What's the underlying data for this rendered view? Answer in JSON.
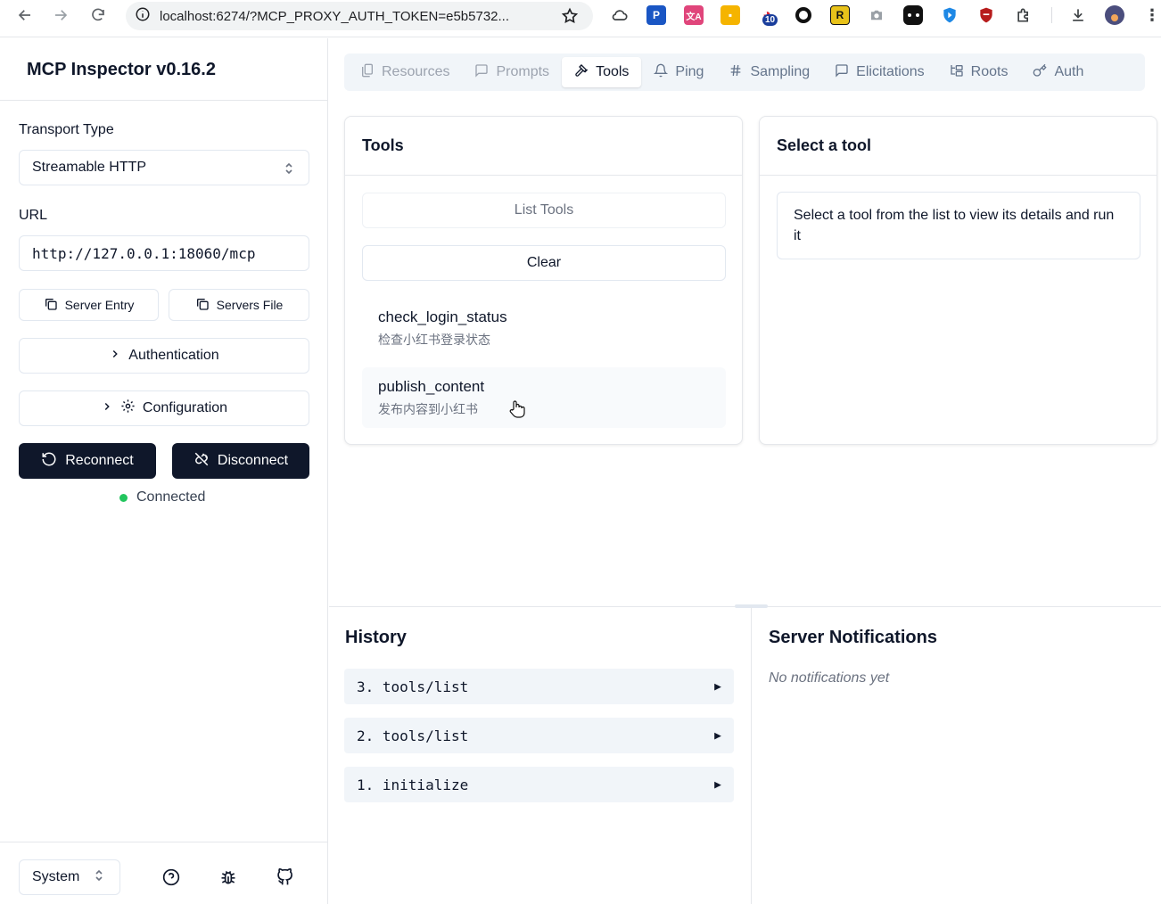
{
  "browser": {
    "url": "localhost:6274/?MCP_PROXY_AUTH_TOKEN=e5b5732...",
    "extension_badge": "10"
  },
  "sidebar": {
    "title": "MCP Inspector v0.16.2",
    "transport_label": "Transport Type",
    "transport_value": "Streamable HTTP",
    "url_label": "URL",
    "url_value": "http://127.0.0.1:18060/mcp",
    "server_entry_label": "Server Entry",
    "servers_file_label": "Servers File",
    "authentication_label": "Authentication",
    "configuration_label": "Configuration",
    "reconnect_label": "Reconnect",
    "disconnect_label": "Disconnect",
    "status_text": "Connected",
    "theme_value": "System"
  },
  "tabs": [
    {
      "label": "Resources",
      "icon": "files-icon",
      "state": "disabled"
    },
    {
      "label": "Prompts",
      "icon": "message-square-icon",
      "state": "disabled"
    },
    {
      "label": "Tools",
      "icon": "hammer-icon",
      "state": "active"
    },
    {
      "label": "Ping",
      "icon": "bell-icon",
      "state": "normal"
    },
    {
      "label": "Sampling",
      "icon": "hash-icon",
      "state": "normal"
    },
    {
      "label": "Elicitations",
      "icon": "message-square-icon",
      "state": "normal"
    },
    {
      "label": "Roots",
      "icon": "folder-tree-icon",
      "state": "normal"
    },
    {
      "label": "Auth",
      "icon": "key-icon",
      "state": "normal"
    }
  ],
  "tools_panel": {
    "title": "Tools",
    "list_tools_label": "List Tools",
    "clear_label": "Clear",
    "items": [
      {
        "name": "check_login_status",
        "description": "检查小红书登录状态"
      },
      {
        "name": "publish_content",
        "description": "发布内容到小红书"
      }
    ]
  },
  "detail_panel": {
    "title": "Select a tool",
    "message": "Select a tool from the list to view its details and run it"
  },
  "history": {
    "title": "History",
    "items": [
      {
        "label": "3. tools/list",
        "expander": "▶"
      },
      {
        "label": "2. tools/list",
        "expander": "▶"
      },
      {
        "label": "1. initialize",
        "expander": "▶"
      }
    ]
  },
  "notifications": {
    "title": "Server Notifications",
    "empty_text": "No notifications yet"
  },
  "colors": {
    "connected": "#22c55e",
    "dark_button": "#0f172a",
    "tabs_bg": "#f1f5f9"
  }
}
